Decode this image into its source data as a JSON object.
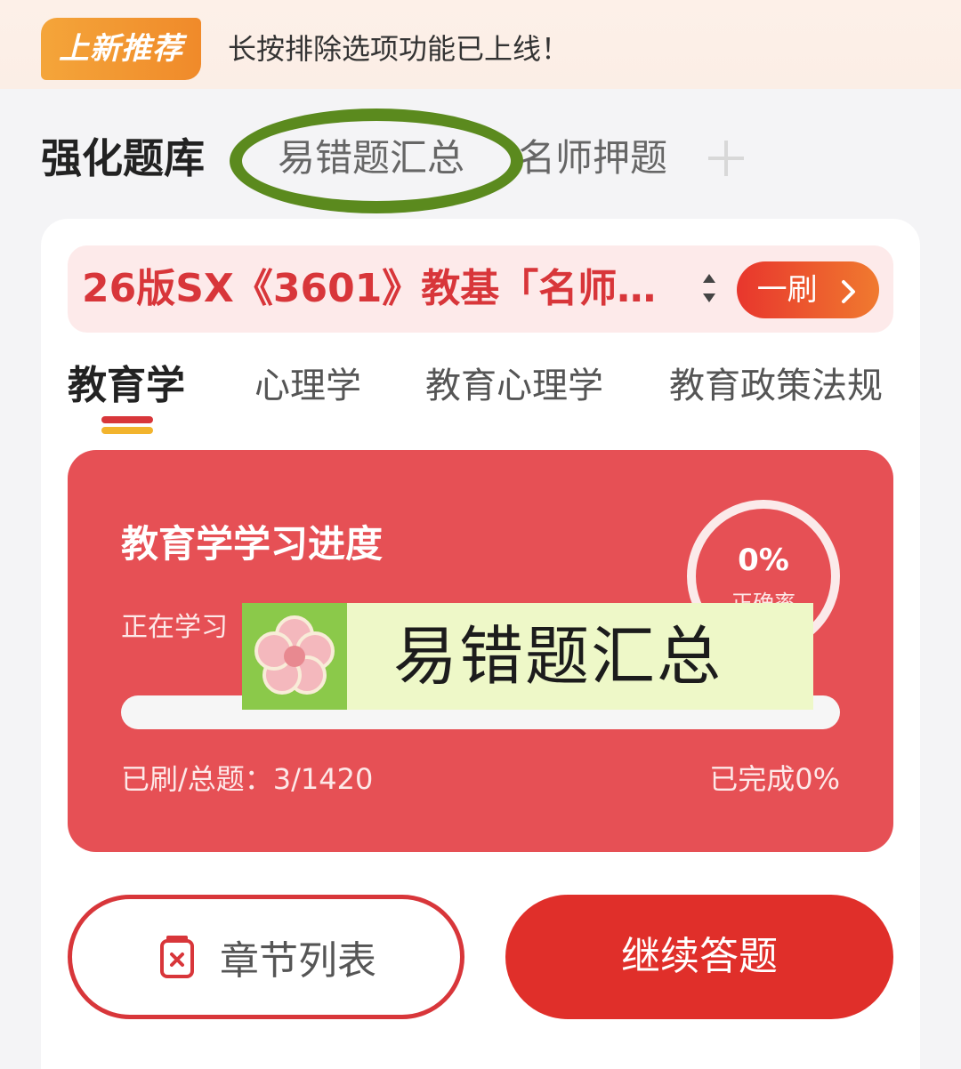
{
  "banner": {
    "badge": "上新推荐",
    "message": "长按排除选项功能已上线！"
  },
  "top_tabs": [
    {
      "label": "强化题库",
      "active": true
    },
    {
      "label": "易错题汇总",
      "active": false
    },
    {
      "label": "名师押题",
      "active": false
    }
  ],
  "course": {
    "title": "26版SX《3601》教基「名师…",
    "round_button": "一刷"
  },
  "subject_tabs": [
    {
      "label": "教育学",
      "active": true
    },
    {
      "label": "心理学",
      "active": false
    },
    {
      "label": "教育心理学",
      "active": false
    },
    {
      "label": "教育政策法规",
      "active": false
    }
  ],
  "progress": {
    "title": "教育学学习进度",
    "current_label": "正在学习",
    "ring_value": "0%",
    "ring_label": "正确率",
    "fraction": 0.0,
    "count_text": "已刷/总题：3/1420",
    "completed_text": "已完成0%"
  },
  "overlay": {
    "caption": "易错题汇总"
  },
  "buttons": {
    "chapter_list": "章节列表",
    "continue": "继续答题"
  },
  "colors": {
    "accent": "#d8363a",
    "card_red": "#e65055",
    "highlight_ring": "#5b8a1e",
    "indicator_yellow": "#f2b42d"
  },
  "icons": {
    "add": "plus-icon",
    "sort": "sort-arrows-icon",
    "chevron": "chevron-right-icon",
    "chapter": "clipboard-icon",
    "flower": "flower-icon"
  }
}
